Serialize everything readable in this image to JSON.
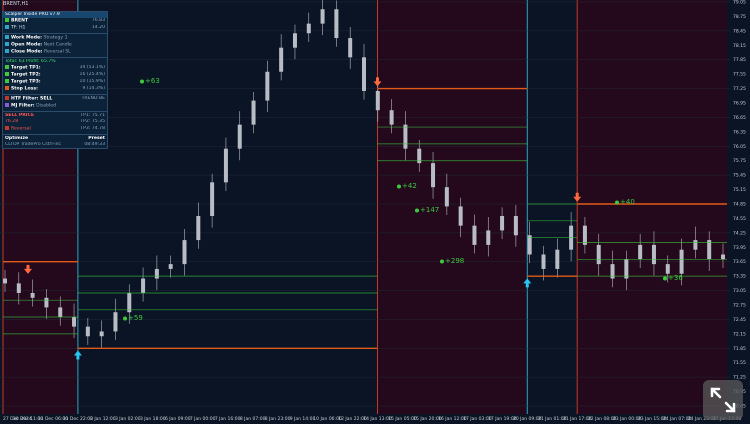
{
  "symbol": "BRENT,H1",
  "colors": {
    "bg_main": "#0a1424",
    "bg_red": "#23091b",
    "grid": "#24303a",
    "candle": "#b8bcc4",
    "sell_border": "#c23b2a",
    "buy_border": "#2aa6c8",
    "tp": "#3ec83e",
    "sl": "#e05a1a",
    "arrow_up": "#26c6f0",
    "arrow_down": "#ff6a3d"
  },
  "panel": {
    "title": "Scalper Inside PRO v7.9",
    "symbol_label": "BRENT",
    "tf_label": "TF: H1",
    "price_top": "76.83",
    "price_mid": "14.20",
    "price_bot": "14.58",
    "work_mode_label": "Work Mode:",
    "work_mode_value": "Strategy 1",
    "open_mode_label": "Open Mode:",
    "open_mode_value": "Next Candle",
    "close_mode_label": "Close Mode:",
    "close_mode_value": "Reversal SL",
    "totals": "Total: 63 Profit: 65.7%",
    "tp1_label": "Target TP1:",
    "tp1_value": "34 (53.1%)",
    "tp2_label": "Target TP2:",
    "tp2_value": "16 (25.4%)",
    "tp3_label": "Target TP3:",
    "tp3_value": "10 (15.9%)",
    "stoploss_label": "Stop Loss:",
    "stoploss_value": "9 (14.3%)",
    "htf_label": "HTF Filter: SELL",
    "htf_value": "TREND BE",
    "mj_label": "MJ Filter:",
    "mj_value": "Disabled",
    "signal_label": "SELL PRICE",
    "signal_price": "76.28",
    "signal_sub": "Reversal",
    "tp_lines": [
      "TP1: 75.71",
      "TP2: 75.35",
      "TP3: 74.78"
    ],
    "optimize_label": "Optimize",
    "preset_label": "Preset",
    "footer_left": "CLTOP TradePro Cstrl-inc",
    "footer_right": "08:49:33"
  },
  "chart_data": {
    "type": "candlestick",
    "title": "",
    "xlabel": "",
    "ylabel": "",
    "price_axis_ticks": [
      "79.05",
      "78.75",
      "78.45",
      "78.15",
      "77.85",
      "77.55",
      "77.25",
      "76.95",
      "76.65",
      "76.35",
      "76.05",
      "75.75",
      "75.45",
      "75.15",
      "74.85",
      "74.55",
      "74.25",
      "73.95",
      "73.65",
      "73.35",
      "73.05",
      "72.75",
      "72.45",
      "72.15",
      "71.85",
      "71.55",
      "71.25",
      "70.95",
      "70.65"
    ],
    "time_axis_ticks": [
      "27 Dec 2024",
      "30 Dec 11:00",
      "31 Dec 06:00",
      "31 Dec 22:00",
      "2 Jan 12:00",
      "3 Jan 02:00",
      "3 Jan 18:00",
      "6 Jan 09:00",
      "7 Jan 00:00",
      "7 Jan 16:00",
      "8 Jan 07:00",
      "8 Jan 23:00",
      "9 Jan 14:00",
      "10 Jan 06:00",
      "12 Jan 22:00",
      "14 Jan 13:00",
      "15 Jan 05:00",
      "15 Jan 20:00",
      "16 Jan 12:00",
      "17 Jan 03:00",
      "17 Jan 19:00",
      "20 Jan 09:00",
      "21 Jan 01:00",
      "21 Jan 17:00",
      "22 Jan 08:00",
      "23 Jan 00:00",
      "23 Jan 15:00",
      "24 Jan 07:00",
      "24 Jan 23:00",
      "27 Jan 13:00"
    ],
    "ohlc_close_approx": [
      73.2,
      73.0,
      72.9,
      72.7,
      72.5,
      72.3,
      72.1,
      72.2,
      72.6,
      73.0,
      73.3,
      73.5,
      73.6,
      74.1,
      74.6,
      75.3,
      76.0,
      76.5,
      77.0,
      77.6,
      78.1,
      78.4,
      78.6,
      78.9,
      78.3,
      77.9,
      77.2,
      76.8,
      76.5,
      76.0,
      75.7,
      75.2,
      74.8,
      74.4,
      74.0,
      74.3,
      74.6,
      74.2,
      73.8,
      73.5,
      73.9,
      74.4,
      74.0,
      73.6,
      73.3,
      73.7,
      74.0,
      73.6,
      73.4,
      73.9,
      74.1,
      73.7,
      73.8
    ],
    "regions": [
      {
        "side": "sell",
        "from": "27 Dec 2024",
        "to": "31 Dec 22:00"
      },
      {
        "side": "buy",
        "from": "31 Dec 22:00",
        "to": "14 Jan 13:00"
      },
      {
        "side": "sell",
        "from": "14 Jan 13:00",
        "to": "20 Jan 09:00"
      },
      {
        "side": "buy",
        "from": "20 Jan 09:00",
        "to": "21 Jan 17:00"
      },
      {
        "side": "sell",
        "from": "21 Jan 17:00",
        "to": "27 Jan 13:00"
      }
    ],
    "signals": [
      {
        "type": "sell",
        "time": "30 Dec 11:00"
      },
      {
        "type": "buy",
        "time": "31 Dec 22:00"
      },
      {
        "type": "sell",
        "time": "14 Jan 13:00"
      },
      {
        "type": "buy",
        "time": "20 Jan 09:00"
      },
      {
        "type": "sell",
        "time": "21 Jan 17:00"
      }
    ],
    "labels": [
      "+63",
      "+59",
      "+42",
      "+147",
      "+298",
      "+40",
      "+36"
    ]
  }
}
